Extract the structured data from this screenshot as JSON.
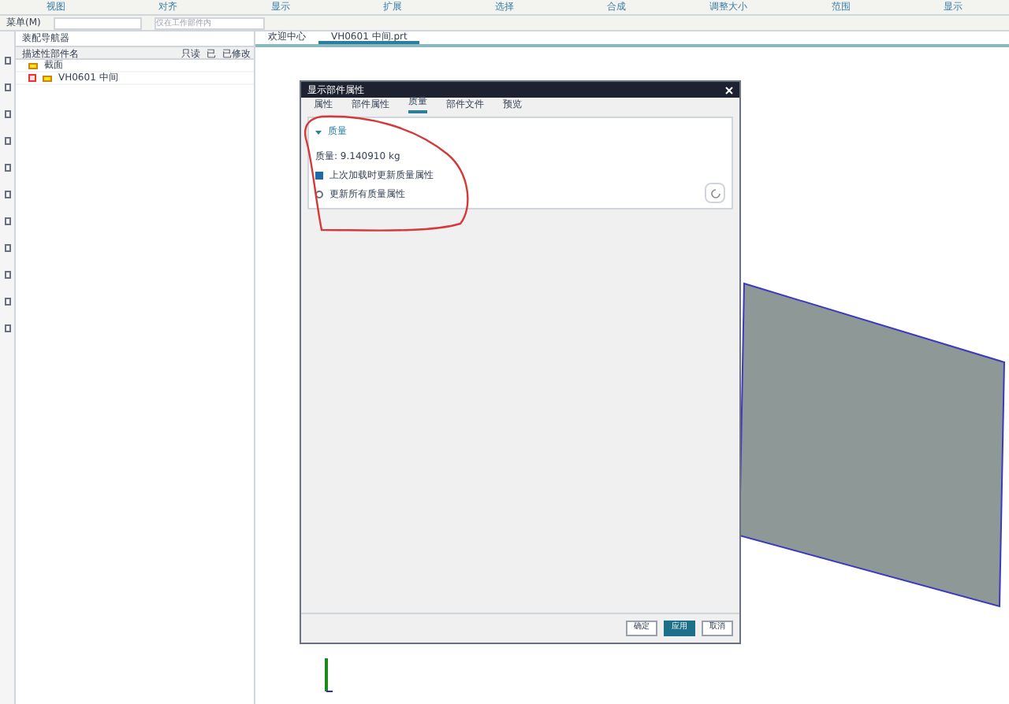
{
  "ribbon_groups": [
    "视图",
    "对齐",
    "显示",
    "扩展",
    "选择",
    "合成",
    "调整大小",
    "范围",
    "显示"
  ],
  "toolbar": {
    "menu": "菜单(M)",
    "filter_placeholder": "仅在工作部件内"
  },
  "navigator": {
    "title": "装配导航器",
    "columns": [
      "描述性部件名",
      "只读",
      "已",
      "已修改"
    ],
    "tree": [
      {
        "label": "截面"
      },
      {
        "label": "VH0601 中间",
        "checked": true
      }
    ]
  },
  "doc_tabs": [
    {
      "label": "欢迎中心",
      "selected": false
    },
    {
      "label": "VH0601 中间.prt",
      "selected": true
    }
  ],
  "dialog": {
    "title": "显示部件属性",
    "tabs": [
      {
        "label": "属性",
        "selected": false
      },
      {
        "label": "部件属性",
        "selected": false
      },
      {
        "label": "质量",
        "selected": true
      },
      {
        "label": "部件文件",
        "selected": false
      },
      {
        "label": "预览",
        "selected": false
      }
    ],
    "section": {
      "title": "质量",
      "expanded": true,
      "mass": "质量: 9.140910 kg",
      "options": [
        {
          "kind": "checkbox",
          "label": "上次加载时更新质量属性",
          "checked": true
        },
        {
          "kind": "radio",
          "label": "更新所有质量属性",
          "checked": false
        }
      ]
    },
    "buttons": [
      {
        "label": "确定",
        "primary": false
      },
      {
        "label": "应用",
        "primary": true
      },
      {
        "label": "取消",
        "primary": false
      }
    ]
  }
}
